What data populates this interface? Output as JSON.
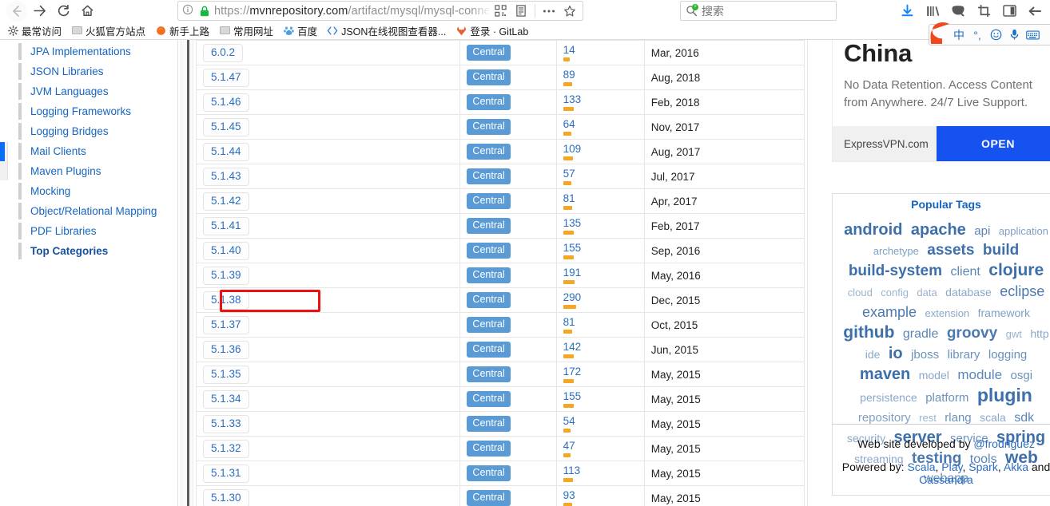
{
  "browser": {
    "nav": {
      "back_icon": "arrow-left-icon",
      "forward_icon": "arrow-right-icon",
      "reload_icon": "reload-icon",
      "home_icon": "home-icon"
    },
    "url": {
      "info_icon": "page-info-icon",
      "lock_icon": "lock-icon",
      "scheme": "https://",
      "host": "mvnrepository.com",
      "path": "/artifact/mysql/mysql-connector-jav",
      "full": "https://mvnrepository.com/artifact/mysql/mysql-connector-jav",
      "reader_icon": "reader-view-icon",
      "qr_icon": "qr-code-icon",
      "menu_icon": "page-actions-icon",
      "bookmark_icon": "star-icon"
    },
    "search": {
      "placeholder": "搜索",
      "icon": "search-icon"
    },
    "toolbar_icons": [
      "downloads-icon",
      "library-icon",
      "pocket-icon",
      "screenshot-icon",
      "sidebar-icon",
      "back-arrow-icon"
    ],
    "bookmarks": [
      {
        "label": "最常访问",
        "icon": "gear-icon"
      },
      {
        "label": "火狐官方站点",
        "icon": "folder-icon"
      },
      {
        "label": "新手上路",
        "icon": "firefox-icon"
      },
      {
        "label": "常用网址",
        "icon": "folder-icon"
      },
      {
        "label": "百度",
        "icon": "baidu-icon"
      },
      {
        "label": "JSON在线视图查看器...",
        "icon": "code-icon"
      },
      {
        "label": "登录 · GitLab",
        "icon": "gitlab-icon"
      }
    ],
    "ime": {
      "logo": "sogou-logo-icon",
      "items": [
        "中",
        "°,",
        "☺",
        "mic-icon",
        "keyboard-icon"
      ]
    }
  },
  "sidebar": {
    "items": [
      {
        "label": "JPA Implementations",
        "bold": false
      },
      {
        "label": "JSON Libraries",
        "bold": false
      },
      {
        "label": "JVM Languages",
        "bold": false
      },
      {
        "label": "Logging Frameworks",
        "bold": false
      },
      {
        "label": "Logging Bridges",
        "bold": false
      },
      {
        "label": "Mail Clients",
        "bold": false
      },
      {
        "label": "Maven Plugins",
        "bold": false
      },
      {
        "label": "Mocking",
        "bold": false
      },
      {
        "label": "Object/Relational Mapping",
        "bold": false
      },
      {
        "label": "PDF Libraries",
        "bold": false
      },
      {
        "label": "Top Categories",
        "bold": true
      }
    ]
  },
  "table": {
    "rows": [
      {
        "version": "6.0.2",
        "repo": "Central",
        "usages": "14",
        "bar": 8,
        "date": "Mar, 2016"
      },
      {
        "version": "5.1.47",
        "repo": "Central",
        "usages": "89",
        "bar": 11,
        "date": "Aug, 2018"
      },
      {
        "version": "5.1.46",
        "repo": "Central",
        "usages": "133",
        "bar": 13,
        "date": "Feb, 2018"
      },
      {
        "version": "5.1.45",
        "repo": "Central",
        "usages": "64",
        "bar": 10,
        "date": "Nov, 2017"
      },
      {
        "version": "5.1.44",
        "repo": "Central",
        "usages": "109",
        "bar": 12,
        "date": "Aug, 2017"
      },
      {
        "version": "5.1.43",
        "repo": "Central",
        "usages": "57",
        "bar": 10,
        "date": "Jul, 2017"
      },
      {
        "version": "5.1.42",
        "repo": "Central",
        "usages": "81",
        "bar": 11,
        "date": "Apr, 2017"
      },
      {
        "version": "5.1.41",
        "repo": "Central",
        "usages": "135",
        "bar": 13,
        "date": "Feb, 2017"
      },
      {
        "version": "5.1.40",
        "repo": "Central",
        "usages": "155",
        "bar": 13,
        "date": "Sep, 2016"
      },
      {
        "version": "5.1.39",
        "repo": "Central",
        "usages": "191",
        "bar": 14,
        "date": "May, 2016"
      },
      {
        "version": "5.1.38",
        "repo": "Central",
        "usages": "290",
        "bar": 16,
        "date": "Dec, 2015"
      },
      {
        "version": "5.1.37",
        "repo": "Central",
        "usages": "81",
        "bar": 11,
        "date": "Oct, 2015"
      },
      {
        "version": "5.1.36",
        "repo": "Central",
        "usages": "142",
        "bar": 13,
        "date": "Jun, 2015"
      },
      {
        "version": "5.1.35",
        "repo": "Central",
        "usages": "172",
        "bar": 13,
        "date": "May, 2015"
      },
      {
        "version": "5.1.34",
        "repo": "Central",
        "usages": "155",
        "bar": 13,
        "date": "May, 2015"
      },
      {
        "version": "5.1.33",
        "repo": "Central",
        "usages": "54",
        "bar": 9,
        "date": "May, 2015"
      },
      {
        "version": "5.1.32",
        "repo": "Central",
        "usages": "47",
        "bar": 9,
        "date": "May, 2015"
      },
      {
        "version": "5.1.31",
        "repo": "Central",
        "usages": "113",
        "bar": 12,
        "date": "May, 2015"
      },
      {
        "version": "5.1.30",
        "repo": "Central",
        "usages": "93",
        "bar": 11,
        "date": "May, 2015"
      }
    ],
    "highlighted_version": "5.1.38",
    "badge_color": "#5b9bd5",
    "bar_color": "#f5a623",
    "annotation_color": "#ef1111"
  },
  "right_panel": {
    "ad": {
      "headline": "China",
      "body": "No Data Retention. Access Content from Anywhere. 24/7 Live Support.",
      "domain": "ExpressVPN.com",
      "cta": "OPEN",
      "cta_color": "#1552f0"
    },
    "tags_title": "Popular Tags",
    "tags": [
      {
        "label": "android",
        "size": 20,
        "color": "#3d6fab"
      },
      {
        "label": "apache",
        "size": 20,
        "color": "#3d6fab"
      },
      {
        "label": "api",
        "size": 15,
        "color": "#5b86b8"
      },
      {
        "label": "application",
        "size": 13,
        "color": "#7fa0c4"
      },
      {
        "label": "archetype",
        "size": 13,
        "color": "#7fa0c4"
      },
      {
        "label": "assets",
        "size": 19,
        "color": "#3d6fab"
      },
      {
        "label": "build",
        "size": 19,
        "color": "#3d6fab"
      },
      {
        "label": "build-system",
        "size": 19,
        "color": "#3d6fab"
      },
      {
        "label": "client",
        "size": 16,
        "color": "#5b86b8"
      },
      {
        "label": "clojure",
        "size": 21,
        "color": "#3d6fab"
      },
      {
        "label": "cloud",
        "size": 13,
        "color": "#9bb3cf"
      },
      {
        "label": "config",
        "size": 13,
        "color": "#9bb3cf"
      },
      {
        "label": "data",
        "size": 13,
        "color": "#9bb3cf"
      },
      {
        "label": "database",
        "size": 14,
        "color": "#8aa8c9"
      },
      {
        "label": "eclipse",
        "size": 18,
        "color": "#4b79b0"
      },
      {
        "label": "example",
        "size": 18,
        "color": "#4b79b0"
      },
      {
        "label": "extension",
        "size": 13,
        "color": "#8aa8c9"
      },
      {
        "label": "framework",
        "size": 14,
        "color": "#7fa0c4"
      },
      {
        "label": "github",
        "size": 21,
        "color": "#3d6fab"
      },
      {
        "label": "gradle",
        "size": 16,
        "color": "#5b86b8"
      },
      {
        "label": "groovy",
        "size": 19,
        "color": "#4b79b0"
      },
      {
        "label": "gwt",
        "size": 13,
        "color": "#9bb3cf"
      },
      {
        "label": "http",
        "size": 14,
        "color": "#8aa8c9"
      },
      {
        "label": "ide",
        "size": 14,
        "color": "#8aa8c9"
      },
      {
        "label": "io",
        "size": 20,
        "color": "#3d6fab"
      },
      {
        "label": "jboss",
        "size": 15,
        "color": "#6a92bd"
      },
      {
        "label": "library",
        "size": 15,
        "color": "#6a92bd"
      },
      {
        "label": "logging",
        "size": 15,
        "color": "#6a92bd"
      },
      {
        "label": "maven",
        "size": 20,
        "color": "#3d6fab"
      },
      {
        "label": "model",
        "size": 14,
        "color": "#8aa8c9"
      },
      {
        "label": "module",
        "size": 17,
        "color": "#5b86b8"
      },
      {
        "label": "osgi",
        "size": 15,
        "color": "#6a92bd"
      },
      {
        "label": "persistence",
        "size": 14,
        "color": "#8aa8c9"
      },
      {
        "label": "platform",
        "size": 15,
        "color": "#6a92bd"
      },
      {
        "label": "plugin",
        "size": 23,
        "color": "#3d6fab"
      },
      {
        "label": "repository",
        "size": 15,
        "color": "#7fa0c4"
      },
      {
        "label": "rest",
        "size": 13,
        "color": "#9bb3cf"
      },
      {
        "label": "rlang",
        "size": 15,
        "color": "#6a92bd"
      },
      {
        "label": "scala",
        "size": 14,
        "color": "#8aa8c9"
      },
      {
        "label": "sdk",
        "size": 16,
        "color": "#5b86b8"
      },
      {
        "label": "security",
        "size": 14,
        "color": "#8aa8c9"
      },
      {
        "label": "server",
        "size": 20,
        "color": "#3d6fab"
      },
      {
        "label": "service",
        "size": 15,
        "color": "#6a92bd"
      },
      {
        "label": "spring",
        "size": 20,
        "color": "#3d6fab"
      },
      {
        "label": "streaming",
        "size": 14,
        "color": "#8aa8c9"
      },
      {
        "label": "testing",
        "size": 19,
        "color": "#4b79b0"
      },
      {
        "label": "tools",
        "size": 16,
        "color": "#5b86b8"
      },
      {
        "label": "web",
        "size": 21,
        "color": "#3d6fab"
      },
      {
        "label": "webapp",
        "size": 16,
        "color": "#6a92bd"
      }
    ],
    "credits": {
      "developed_prefix": "Web site developed by ",
      "developed_handle": "@frodriguez",
      "powered_prefix": "Powered by: ",
      "powered_links": [
        "Scala",
        "Play",
        "Spark",
        "Akka"
      ],
      "powered_and": " and ",
      "powered_last": "Cassandra"
    }
  }
}
